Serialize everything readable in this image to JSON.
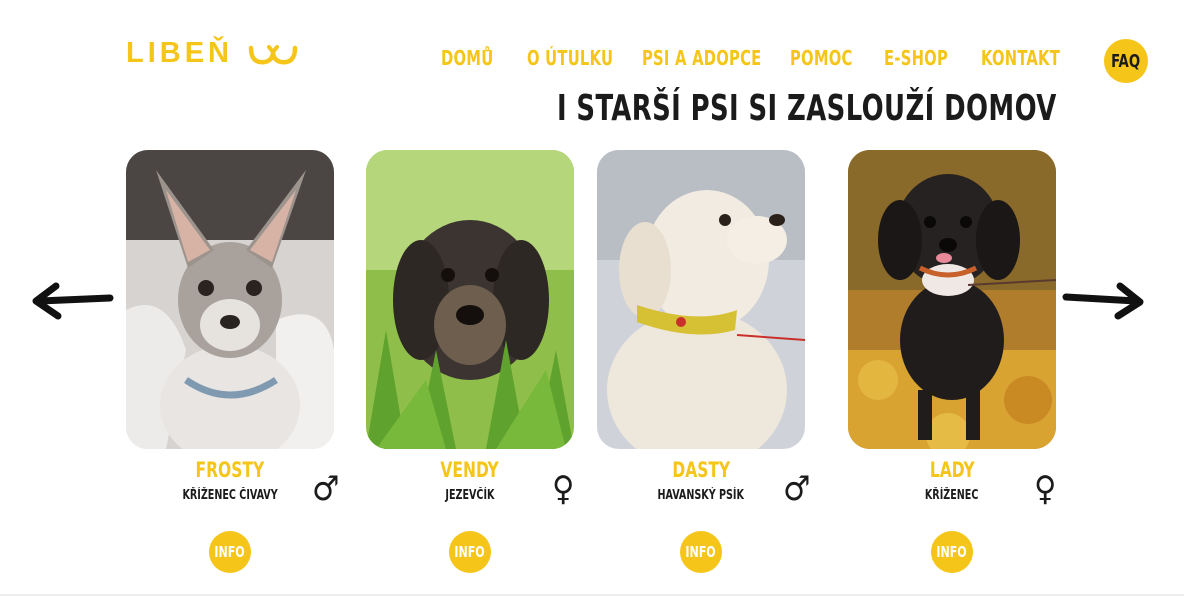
{
  "brand": {
    "logo_text": "LIBEŇ",
    "logo_icon": "cat-whiskers-icon",
    "accent": "#f5c519",
    "dark": "#1b1b1b"
  },
  "nav": {
    "items": [
      {
        "label": "DOMŮ"
      },
      {
        "label": "O ÚTULKU"
      },
      {
        "label": "PSI A ADOPCE"
      },
      {
        "label": "POMOC"
      },
      {
        "label": "E-SHOP"
      },
      {
        "label": "KONTAKT"
      }
    ],
    "faq_label": "FAQ"
  },
  "hero": {
    "title": "I STARŠÍ PSI SI ZASLOUŽÍ DOMOV"
  },
  "carousel": {
    "prev_icon": "arrow-left-icon",
    "next_icon": "arrow-right-icon",
    "dogs": [
      {
        "name": "FROSTY",
        "breed": "KŘÍŽENEC ČIVAVY",
        "gender_symbol": "♂",
        "gender": "male",
        "info_label": "INFO"
      },
      {
        "name": "VENDY",
        "breed": "JEZEVČÍK",
        "gender_symbol": "♀",
        "gender": "female",
        "info_label": "INFO"
      },
      {
        "name": "DASTY",
        "breed": "HAVANSKÝ PSÍK",
        "gender_symbol": "♂",
        "gender": "male",
        "info_label": "INFO"
      },
      {
        "name": "LADY",
        "breed": "KŘÍŽENEC",
        "gender_symbol": "♀",
        "gender": "female",
        "info_label": "INFO"
      }
    ]
  }
}
